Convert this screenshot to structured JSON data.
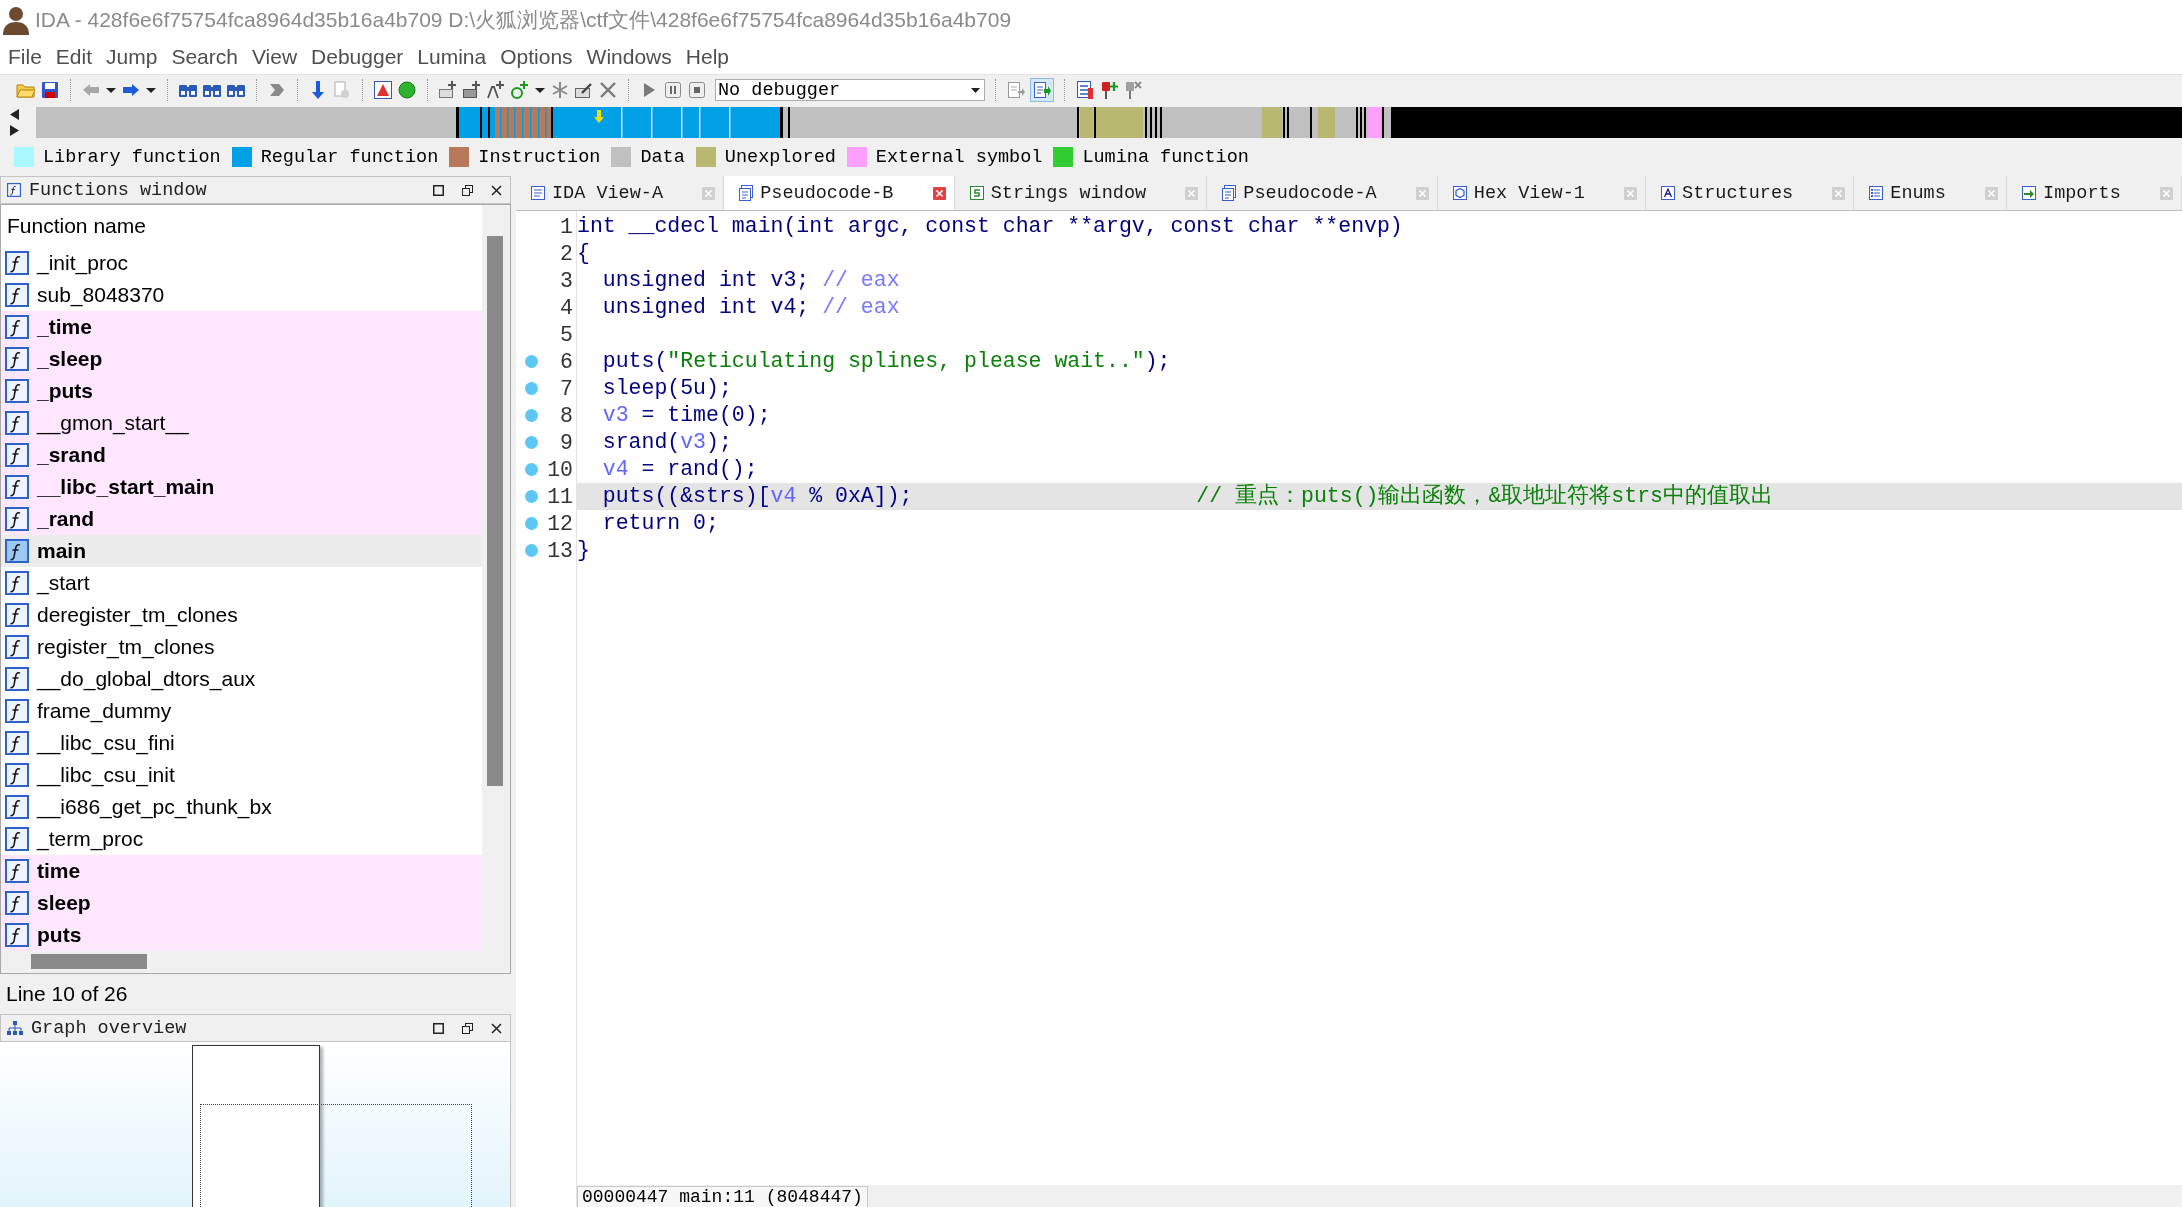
{
  "window": {
    "title": "IDA - 428f6e6f75754fca8964d35b16a4b709 D:\\火狐浏览器\\ctf文件\\428f6e6f75754fca8964d35b16a4b709"
  },
  "menu": [
    "File",
    "Edit",
    "Jump",
    "Search",
    "View",
    "Debugger",
    "Lumina",
    "Options",
    "Windows",
    "Help"
  ],
  "toolbar": {
    "debugger_select": "No debugger"
  },
  "legend": [
    {
      "label": "Library function",
      "color": "#a8f8ff"
    },
    {
      "label": "Regular function",
      "color": "#00a0e6"
    },
    {
      "label": "Instruction",
      "color": "#b8785a"
    },
    {
      "label": "Data",
      "color": "#c0c0c0"
    },
    {
      "label": "Unexplored",
      "color": "#b8b870"
    },
    {
      "label": "External symbol",
      "color": "#ffa0ff"
    },
    {
      "label": "Lumina function",
      "color": "#33cc33"
    }
  ],
  "functions_window": {
    "title": "Functions window",
    "column": "Function name",
    "rows": [
      {
        "name": "_init_proc",
        "bold": false,
        "external": false,
        "selected": false
      },
      {
        "name": "sub_8048370",
        "bold": false,
        "external": false,
        "selected": false
      },
      {
        "name": "_time",
        "bold": true,
        "external": true,
        "selected": false
      },
      {
        "name": "_sleep",
        "bold": true,
        "external": true,
        "selected": false
      },
      {
        "name": "_puts",
        "bold": true,
        "external": true,
        "selected": false
      },
      {
        "name": "__gmon_start__",
        "bold": false,
        "external": true,
        "selected": false
      },
      {
        "name": "_srand",
        "bold": true,
        "external": true,
        "selected": false
      },
      {
        "name": "__libc_start_main",
        "bold": true,
        "external": true,
        "selected": false
      },
      {
        "name": "_rand",
        "bold": true,
        "external": true,
        "selected": false
      },
      {
        "name": "main",
        "bold": true,
        "external": false,
        "selected": true
      },
      {
        "name": "_start",
        "bold": false,
        "external": false,
        "selected": false
      },
      {
        "name": "deregister_tm_clones",
        "bold": false,
        "external": false,
        "selected": false
      },
      {
        "name": "register_tm_clones",
        "bold": false,
        "external": false,
        "selected": false
      },
      {
        "name": "__do_global_dtors_aux",
        "bold": false,
        "external": false,
        "selected": false
      },
      {
        "name": "frame_dummy",
        "bold": false,
        "external": false,
        "selected": false
      },
      {
        "name": "__libc_csu_fini",
        "bold": false,
        "external": false,
        "selected": false
      },
      {
        "name": "__libc_csu_init",
        "bold": false,
        "external": false,
        "selected": false
      },
      {
        "name": "__i686_get_pc_thunk_bx",
        "bold": false,
        "external": false,
        "selected": false
      },
      {
        "name": "_term_proc",
        "bold": false,
        "external": false,
        "selected": false
      },
      {
        "name": "time",
        "bold": true,
        "external": true,
        "selected": false
      },
      {
        "name": "sleep",
        "bold": true,
        "external": true,
        "selected": false
      },
      {
        "name": "puts",
        "bold": true,
        "external": true,
        "selected": false
      }
    ],
    "status": "Line 10 of 26"
  },
  "graph_overview": {
    "title": "Graph overview"
  },
  "tabs": [
    {
      "label": "IDA View-A",
      "kind": "disassembly",
      "selected": false
    },
    {
      "label": "Pseudocode-B",
      "kind": "pseudocode",
      "selected": true
    },
    {
      "label": "Strings window",
      "kind": "strings",
      "selected": false
    },
    {
      "label": "Pseudocode-A",
      "kind": "pseudocode",
      "selected": false
    },
    {
      "label": "Hex View-1",
      "kind": "hex",
      "selected": false
    },
    {
      "label": "Structures",
      "kind": "structures",
      "selected": false
    },
    {
      "label": "Enums",
      "kind": "enums",
      "selected": false
    },
    {
      "label": "Imports",
      "kind": "imports",
      "selected": false
    }
  ],
  "pseudocode": {
    "lines": [
      {
        "number": "1",
        "marked": false,
        "highlighted": false,
        "segments": [
          {
            "kind": "code",
            "text": "int __cdecl main(int argc, const char **argv, const char **envp)"
          }
        ]
      },
      {
        "number": "2",
        "marked": false,
        "highlighted": false,
        "segments": [
          {
            "kind": "code",
            "text": "{"
          }
        ]
      },
      {
        "number": "3",
        "marked": false,
        "highlighted": false,
        "segments": [
          {
            "kind": "code",
            "text": "  unsigned int v3; "
          },
          {
            "kind": "auto_comment",
            "text": "// eax"
          }
        ]
      },
      {
        "number": "4",
        "marked": false,
        "highlighted": false,
        "segments": [
          {
            "kind": "code",
            "text": "  unsigned int v4; "
          },
          {
            "kind": "auto_comment",
            "text": "// eax"
          }
        ]
      },
      {
        "number": "5",
        "marked": false,
        "highlighted": false
      },
      {
        "number": "6",
        "marked": true,
        "highlighted": false,
        "segments": [
          {
            "kind": "code",
            "text": "  puts("
          },
          {
            "kind": "string",
            "text": "\"Reticulating splines, please wait..\""
          },
          {
            "kind": "code",
            "text": ");"
          }
        ]
      },
      {
        "number": "7",
        "marked": true,
        "highlighted": false,
        "segments": [
          {
            "kind": "code",
            "text": "  sleep(5u);"
          }
        ]
      },
      {
        "number": "8",
        "marked": true,
        "highlighted": false,
        "segments": [
          {
            "kind": "var",
            "text": "  v3"
          },
          {
            "kind": "code",
            "text": " = time(0);"
          }
        ]
      },
      {
        "number": "9",
        "marked": true,
        "highlighted": false,
        "segments": [
          {
            "kind": "code",
            "text": "  srand("
          },
          {
            "kind": "var",
            "text": "v3"
          },
          {
            "kind": "code",
            "text": ");"
          }
        ]
      },
      {
        "number": "10",
        "marked": true,
        "highlighted": false,
        "segments": [
          {
            "kind": "var",
            "text": "  v4"
          },
          {
            "kind": "code",
            "text": " = rand();"
          }
        ]
      },
      {
        "number": "11",
        "marked": true,
        "highlighted": true,
        "segments": [
          {
            "kind": "code",
            "text": "  puts((&strs)["
          },
          {
            "kind": "var",
            "text": "v4"
          },
          {
            "kind": "code",
            "text": " % 0xA]);"
          },
          {
            "kind": "comment",
            "text": "// 重点：puts()输出函数，&取地址符将strs中的值取出"
          }
        ]
      },
      {
        "number": "12",
        "marked": true,
        "highlighted": false,
        "segments": [
          {
            "kind": "code",
            "text": "  return 0;"
          }
        ]
      },
      {
        "number": "13",
        "marked": true,
        "highlighted": false,
        "segments": [
          {
            "kind": "code",
            "text": "}"
          }
        ]
      }
    ],
    "status": "00000447 main:11 (8048447)"
  }
}
